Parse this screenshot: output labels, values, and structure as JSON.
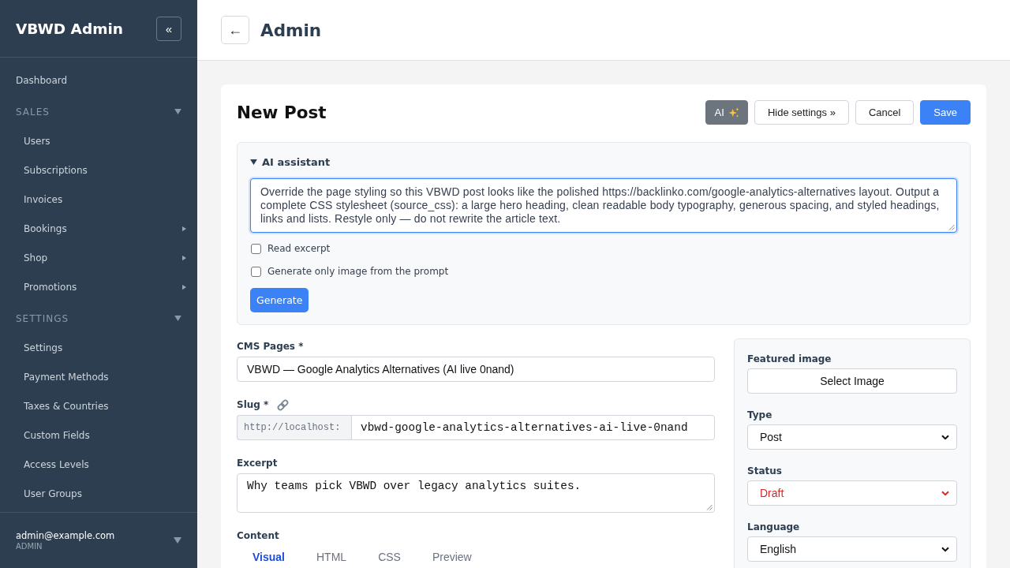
{
  "sidebar": {
    "brand": "VBWD Admin",
    "collapse_button": "«",
    "items": [
      {
        "kind": "link",
        "label": "Dashboard"
      },
      {
        "kind": "section",
        "label": "SALES",
        "expanded": true,
        "children": [
          {
            "kind": "link",
            "label": "Users"
          },
          {
            "kind": "link",
            "label": "Subscriptions"
          },
          {
            "kind": "link",
            "label": "Invoices"
          },
          {
            "kind": "submenu",
            "label": "Bookings",
            "expanded": false
          },
          {
            "kind": "submenu",
            "label": "Shop",
            "expanded": false
          },
          {
            "kind": "submenu",
            "label": "Promotions",
            "expanded": false
          }
        ]
      },
      {
        "kind": "section",
        "label": "SETTINGS",
        "expanded": true,
        "children": [
          {
            "kind": "link",
            "label": "Settings"
          },
          {
            "kind": "link",
            "label": "Payment Methods"
          },
          {
            "kind": "link",
            "label": "Taxes & Countries"
          },
          {
            "kind": "link",
            "label": "Custom Fields"
          },
          {
            "kind": "link",
            "label": "Access Levels"
          },
          {
            "kind": "link",
            "label": "User Groups"
          }
        ]
      }
    ],
    "user": {
      "email": "admin@example.com",
      "role": "ADMIN"
    }
  },
  "header": {
    "back_button": "←",
    "title": "Admin"
  },
  "editor": {
    "title": "New Post",
    "actions": [
      {
        "kind": "ai",
        "label": "AI"
      },
      {
        "kind": "secondary",
        "label": "Hide settings »"
      },
      {
        "kind": "secondary",
        "label": "Cancel"
      },
      {
        "kind": "primary",
        "label": "Save"
      }
    ],
    "ai_assistant": {
      "title": "AI assistant",
      "expanded": true,
      "prompt": "Override the page styling so this VBWD post looks like the polished https://backlinko.com/google-analytics-alternatives layout. Output a complete CSS stylesheet (source_css): a large hero heading, clean readable body typography, generous spacing, and styled headings, links and lists. Restyle only — do not rewrite the article text.",
      "options": [
        {
          "label": "Read excerpt",
          "checked": false
        },
        {
          "label": "Generate only image from the prompt",
          "checked": false
        }
      ],
      "generate_button": "Generate"
    },
    "fields": [
      {
        "kind": "text",
        "label": "CMS Pages *",
        "value": "VBWD — Google Analytics Alternatives (AI live 0nand)"
      },
      {
        "kind": "slug",
        "label": "Slug *",
        "prefix": "http://localhost:",
        "value": "vbwd-google-analytics-alternatives-ai-live-0nand"
      },
      {
        "kind": "textarea",
        "label": "Excerpt",
        "value": "Why teams pick VBWD over legacy analytics suites."
      }
    ],
    "content": {
      "label": "Content",
      "tabs": [
        {
          "label": "Visual",
          "selected": true
        },
        {
          "label": "HTML",
          "selected": false
        },
        {
          "label": "CSS",
          "selected": false
        },
        {
          "label": "Preview",
          "selected": false
        }
      ]
    },
    "settings_panel": {
      "fields": [
        {
          "kind": "button",
          "label": "Featured image",
          "value": "Select Image"
        },
        {
          "kind": "select",
          "label": "Type",
          "value": "Post"
        },
        {
          "kind": "select",
          "label": "Status",
          "value": "Draft",
          "color": "#dc2626"
        },
        {
          "kind": "select",
          "label": "Language",
          "value": "English"
        }
      ]
    }
  }
}
